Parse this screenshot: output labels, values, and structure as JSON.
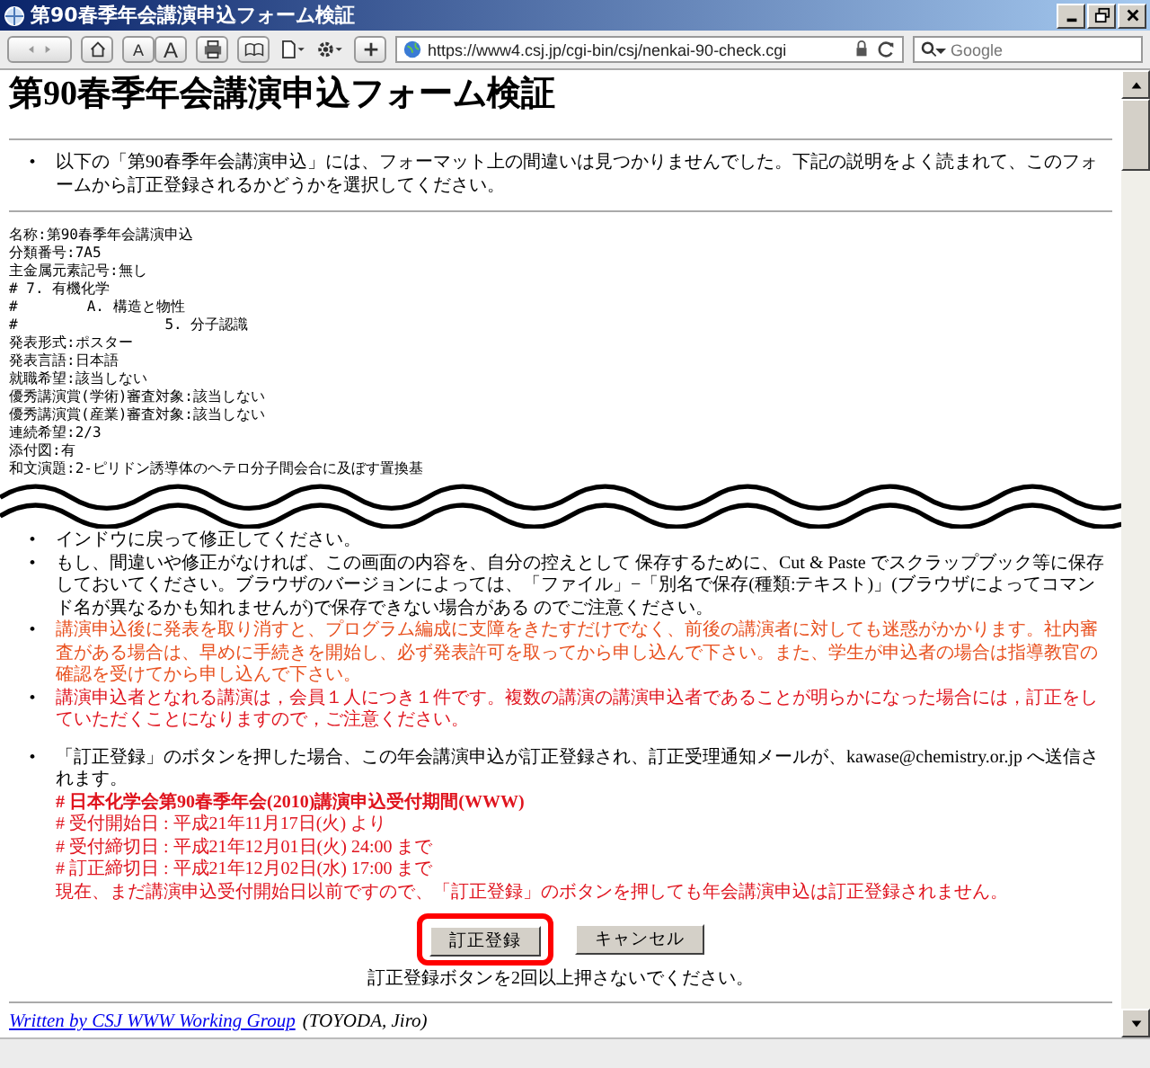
{
  "window": {
    "title": "第90春季年会講演申込フォーム検証"
  },
  "toolbar": {
    "url": "https://www4.csj.jp/cgi-bin/csj/nenkai-90-check.cgi",
    "search_placeholder": "Google",
    "text_size_buttons": [
      "A",
      "A"
    ]
  },
  "page": {
    "bullet": "•",
    "heading": "第90春季年会講演申込フォーム検証",
    "intro": "以下の「第90春季年会講演申込」には、フォーマット上の間違いは見つかりませんでした。下記の説明をよく読まれて、このフォームから訂正登録されるかどうかを選択してください。",
    "form_fields": [
      "名称:第90春季年会講演申込",
      "分類番号:7A5",
      "主金属元素記号:無し",
      "# 7. 有機化学",
      "#        A. 構造と物性",
      "#                 5. 分子認識",
      "発表形式:ポスター",
      "発表言語:日本語",
      "就職希望:該当しない",
      "優秀講演賞(学術)審査対象:該当しない",
      "優秀講演賞(産業)審査対象:該当しない",
      "連続希望:2/3",
      "添付図:有",
      "和文演題:2-ピリドン誘導体のヘテロ分子間会合に及ぼす置換基"
    ],
    "notes": [
      {
        "text": "インドウに戻って修正してください。",
        "color": "#000000"
      },
      {
        "text": "もし、間違いや修正がなければ、この画面の内容を、自分の控えとして 保存するために、Cut & Paste でスクラップブック等に保存しておいてください。ブラウザのバージョンによっては、「ファイル」−「別名で保存(種類:テキスト)」(ブラウザによってコマンド名が異なるかも知れませんが)で保存できない場合がある のでご注意ください。",
        "color": "#000000"
      },
      {
        "text": "講演申込後に発表を取り消すと、プログラム編成に支障をきたすだけでなく、前後の講演者に対しても迷惑がかかります。社内審査がある場合は、早めに手続きを開始し、必ず発表許可を取ってから申し込んで下さい。また、学生が申込者の場合は指導教官の確認を受けてから申し込んで下さい。",
        "color": "#e8501e"
      },
      {
        "text": "講演申込者となれる講演は，会員１人につき１件です。複数の講演の講演申込者であることが明らかになった場合には，訂正をしていただくことになりますので，ご注意ください。",
        "color": "#e0141e"
      }
    ],
    "submit_note": {
      "text": "「訂正登録」のボタンを押した場合、この年会講演申込が訂正登録され、訂正受理通知メールが、kawase@chemistry.or.jp へ送信されます。",
      "lines": [
        {
          "text": "# 日本化学会第90春季年会(2010)講演申込受付期間(WWW)",
          "bold": true
        },
        {
          "text": "# 受付開始日 : 平成21年11月17日(火) より",
          "bold": false
        },
        {
          "text": "# 受付締切日 : 平成21年12月01日(火) 24:00 まで",
          "bold": false
        },
        {
          "text": "# 訂正締切日 : 平成21年12月02日(水) 17:00 まで",
          "bold": false
        },
        {
          "text": "現在、まだ講演申込受付開始日以前ですので、「訂正登録」のボタンを押しても年会講演申込は訂正登録されません。",
          "bold": false
        }
      ]
    },
    "buttons": [
      {
        "label": "訂正登録",
        "highlighted": true
      },
      {
        "label": "キャンセル",
        "highlighted": false
      }
    ],
    "warning": "訂正登録ボタンを2回以上押さないでください。",
    "footer": {
      "link": "Written by CSJ WWW Working Group",
      "author": "(TOYODA, Jiro)"
    }
  }
}
